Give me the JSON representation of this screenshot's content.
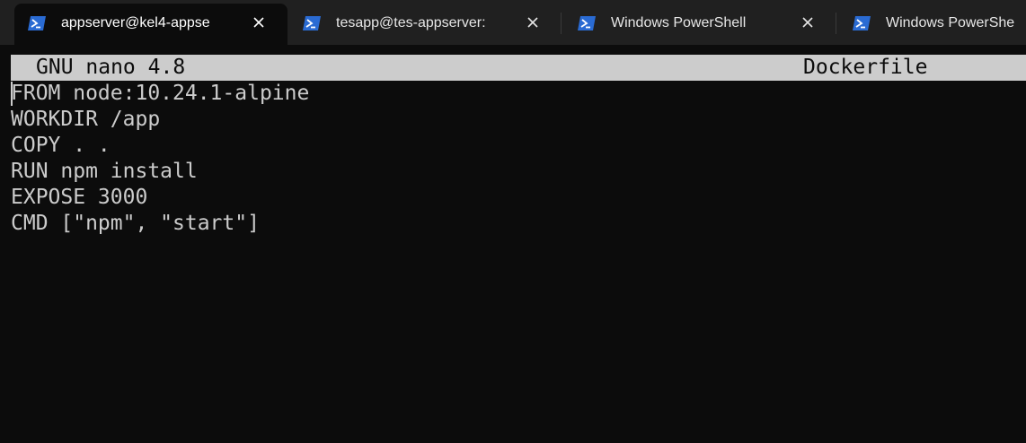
{
  "tabs": [
    {
      "title": "appserver@kel4-appse",
      "active": true,
      "icon": "powershell-icon",
      "closable": true
    },
    {
      "title": "tesapp@tes-appserver:",
      "active": false,
      "icon": "powershell-icon",
      "closable": true
    },
    {
      "title": "Windows PowerShell",
      "active": false,
      "icon": "powershell-icon",
      "closable": true
    },
    {
      "title": "Windows PowerShe",
      "active": false,
      "icon": "powershell-icon",
      "closable": false
    }
  ],
  "nano": {
    "version": "GNU nano 4.8",
    "filename": "Dockerfile"
  },
  "editor": {
    "lines": [
      "FROM node:10.24.1-alpine",
      "WORKDIR /app",
      "COPY . .",
      "RUN npm install",
      "EXPOSE 3000",
      "CMD [\"npm\", \"start\"]"
    ]
  },
  "colors": {
    "terminal_bg": "#0c0c0c",
    "tabbar_bg": "#202020",
    "terminal_fg": "#cccccc",
    "powershell_blue": "#2a6bd3"
  }
}
